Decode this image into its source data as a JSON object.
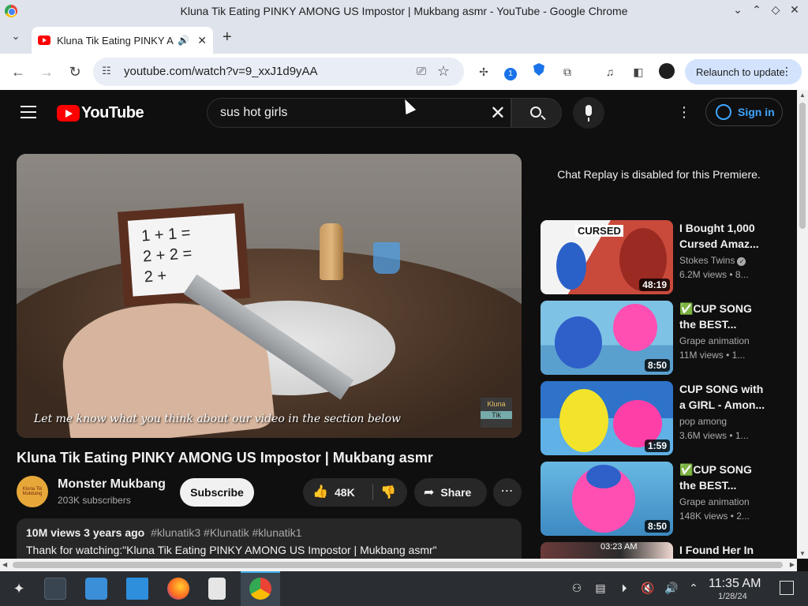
{
  "window": {
    "title": "Kluna Tik Eating PINKY AMONG US Impostor | Mukbang asmr - YouTube - Google Chrome",
    "controls": [
      "⌄",
      "⌃",
      "◇",
      "✕"
    ]
  },
  "tab": {
    "title": "Kluna Tik Eating PINKY AMONG US Impostor | Mukbang asmr",
    "close": "✕",
    "new": "+"
  },
  "toolbar": {
    "url": "youtube.com/watch?v=9_xxJ1d9yAA",
    "extension_badge": "1",
    "relaunch_label": "Relaunch to update"
  },
  "youtube": {
    "logo_text": "YouTube",
    "search_query": "sus hot girls",
    "signin_label": "Sign in",
    "video": {
      "caption": "Let me know what you think about our video in the section below",
      "math": [
        "1 + 1 =",
        "2 + 2 =",
        "2 +"
      ],
      "watermark_top": "Kluna",
      "watermark_bottom": "Tik",
      "title": "Kluna Tik Eating PINKY AMONG US Impostor | Mukbang asmr"
    },
    "channel": {
      "name": "Monster Mukbang",
      "subscribers": "203K subscribers",
      "avatar_text": "Kluna Tik Mukbang",
      "subscribe_label": "Subscribe"
    },
    "actions": {
      "likes": "48K",
      "share_label": "Share"
    },
    "description": {
      "views": "10M views",
      "age": "3 years ago",
      "tags": "#klunatik3 #Klunatik #klunatik1",
      "text": "Thank for watching:\"Kluna Tik Eating PINKY AMONG US Impostor | Mukbang asmr\""
    },
    "chat_replay": "Chat Replay is disabled for this Premiere.",
    "recommendations": [
      {
        "title": "I Bought 1,000 Cursed Amaz...",
        "channel": "Stokes Twins",
        "views": "6.2M views • 8...",
        "duration": "48:19",
        "thumb_text": "CURSED"
      },
      {
        "title": "✅CUP SONG the BEST...",
        "channel": "Grape animation",
        "views": "11M views • 1...",
        "duration": "8:50"
      },
      {
        "title": "CUP SONG with a GIRL - Amon...",
        "channel": "pop among",
        "views": "3.6M views • 1...",
        "duration": "1:59"
      },
      {
        "title": "✅CUP SONG the BEST...",
        "channel": "Grape animation",
        "views": "148K views • 2...",
        "duration": "8:50"
      },
      {
        "title": "I Found Her In",
        "thumb_time": "03:23 AM"
      }
    ]
  },
  "taskbar": {
    "time": "11:35 AM",
    "date": "1/28/24"
  },
  "colors": {
    "youtube_red": "#ff0000",
    "link_blue": "#3ea6ff",
    "chrome_frame": "#dee3ec"
  }
}
